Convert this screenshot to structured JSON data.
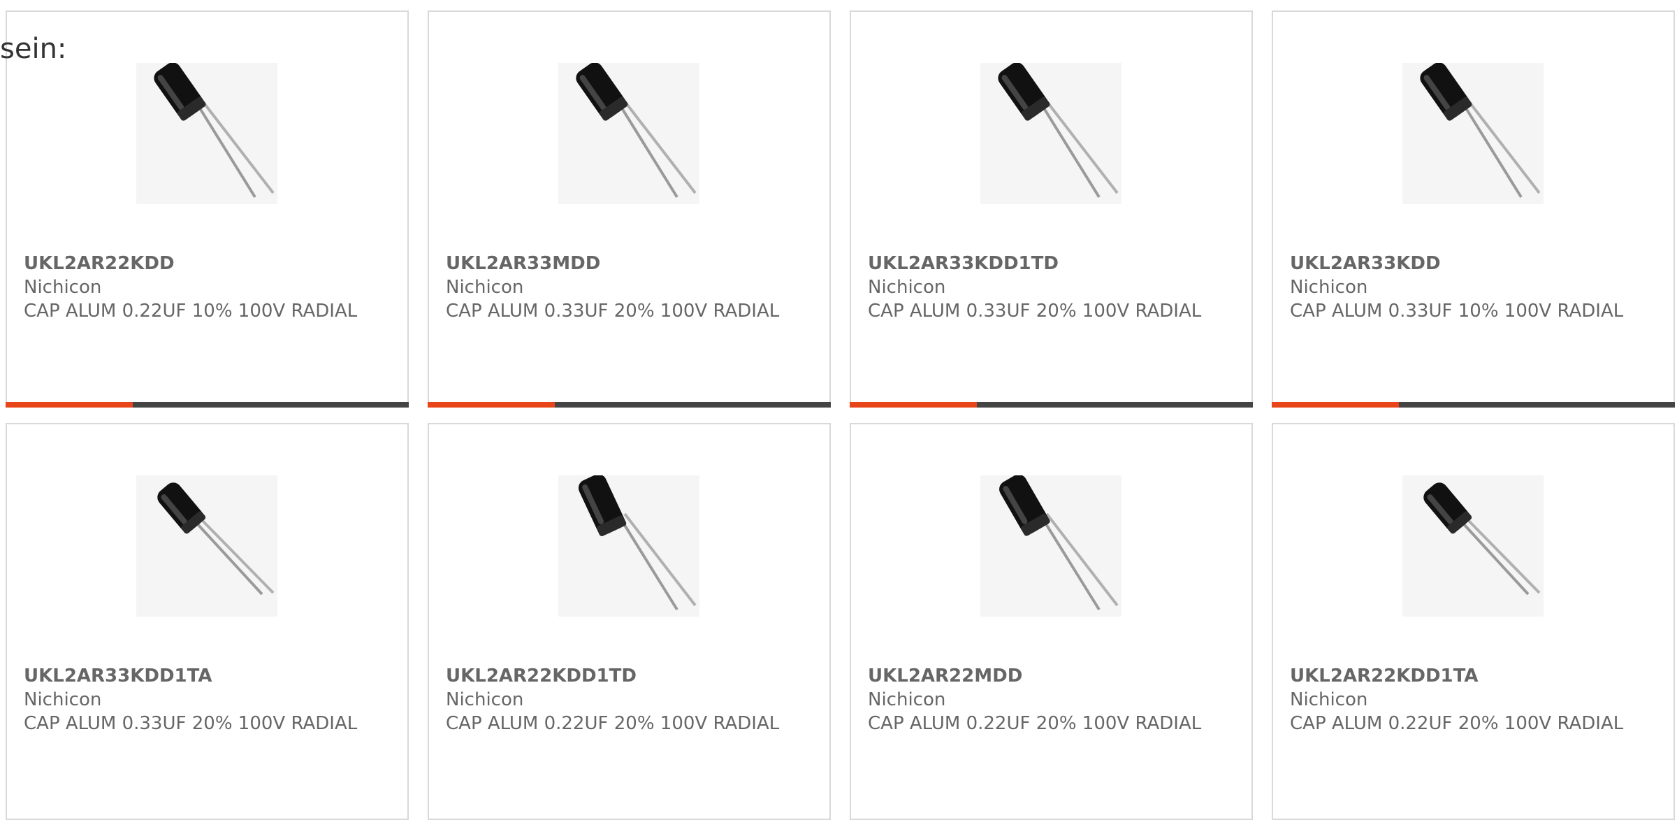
{
  "intro": {
    "text": "sein:"
  },
  "colors": {
    "accent": "#e8461a",
    "bar": "#444444",
    "border": "#d9d9d9",
    "text": "#666666"
  },
  "products": [
    {
      "part": "UKL2AR22KDD",
      "maker": "Nichicon",
      "desc": "CAP ALUM 0.22UF 10% 100V RADIAL",
      "icon": "capacitor-icon"
    },
    {
      "part": "UKL2AR33MDD",
      "maker": "Nichicon",
      "desc": "CAP ALUM 0.33UF 20% 100V RADIAL",
      "icon": "capacitor-icon"
    },
    {
      "part": "UKL2AR33KDD1TD",
      "maker": "Nichicon",
      "desc": "CAP ALUM 0.33UF 20% 100V RADIAL",
      "icon": "capacitor-icon"
    },
    {
      "part": "UKL2AR33KDD",
      "maker": "Nichicon",
      "desc": "CAP ALUM 0.33UF 10% 100V RADIAL",
      "icon": "capacitor-icon"
    },
    {
      "part": "UKL2AR33KDD1TA",
      "maker": "Nichicon",
      "desc": "CAP ALUM 0.33UF 20% 100V RADIAL",
      "icon": "capacitor-icon"
    },
    {
      "part": "UKL2AR22KDD1TD",
      "maker": "Nichicon",
      "desc": "CAP ALUM 0.22UF 20% 100V RADIAL",
      "icon": "capacitor-icon"
    },
    {
      "part": "UKL2AR22MDD",
      "maker": "Nichicon",
      "desc": "CAP ALUM 0.22UF 20% 100V RADIAL",
      "icon": "capacitor-icon"
    },
    {
      "part": "UKL2AR22KDD1TA",
      "maker": "Nichicon",
      "desc": "CAP ALUM 0.22UF 20% 100V RADIAL",
      "icon": "capacitor-icon"
    }
  ]
}
